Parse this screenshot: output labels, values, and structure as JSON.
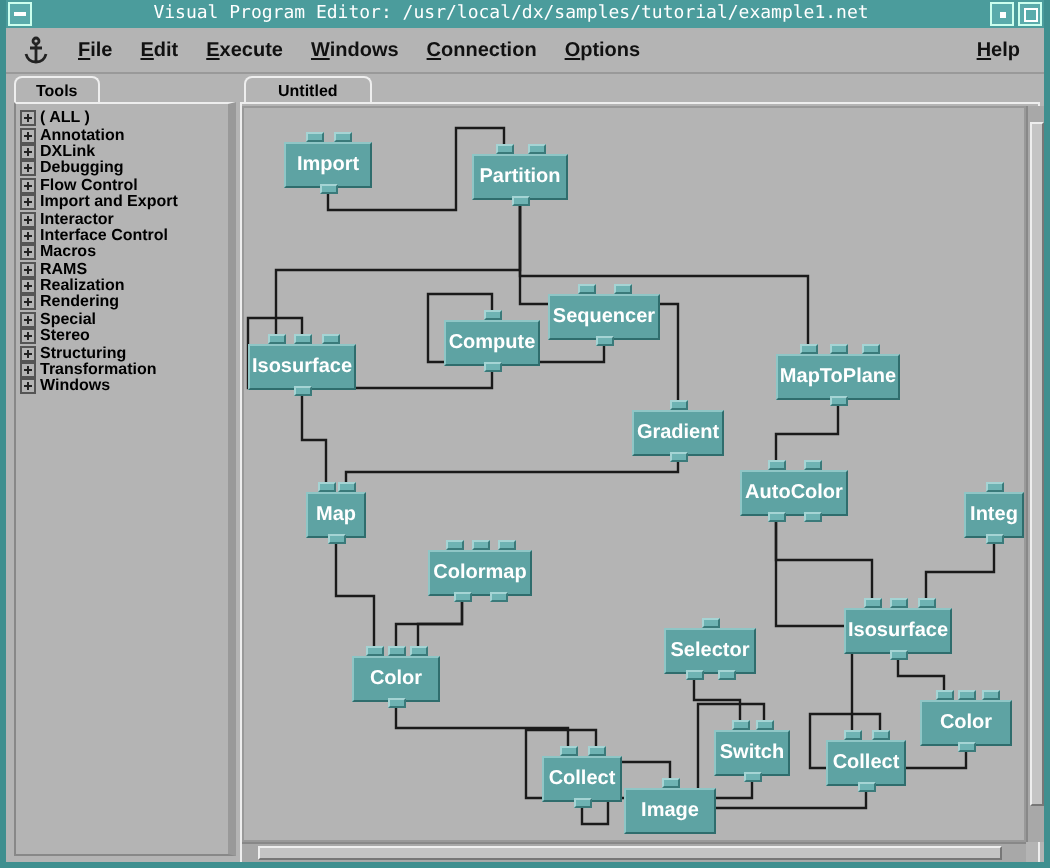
{
  "window": {
    "title": "Visual Program Editor: /usr/local/dx/samples/tutorial/example1.net"
  },
  "menus": [
    "File",
    "Edit",
    "Execute",
    "Windows",
    "Connection",
    "Options"
  ],
  "help_menu": "Help",
  "tools_panel": {
    "tab": "Tools",
    "categories": [
      "( ALL )",
      "Annotation",
      "DXLink",
      "Debugging",
      "Flow Control",
      "Import and Export",
      "Interactor",
      "Interface Control",
      "Macros",
      "RAMS",
      "Realization",
      "Rendering",
      "Special",
      "Stereo",
      "Structuring",
      "Transformation",
      "Windows"
    ]
  },
  "canvas": {
    "tab": "Untitled",
    "modules": [
      {
        "label": "Import"
      },
      {
        "label": "Partition"
      },
      {
        "label": "Isosurface"
      },
      {
        "label": "Compute"
      },
      {
        "label": "Sequencer"
      },
      {
        "label": "Gradient"
      },
      {
        "label": "MapToPlane"
      },
      {
        "label": "AutoColor"
      },
      {
        "label": "Map"
      },
      {
        "label": "Colormap"
      },
      {
        "label": "Color"
      },
      {
        "label": "Selector"
      },
      {
        "label": "Switch"
      },
      {
        "label": "Collect"
      },
      {
        "label": "Image"
      },
      {
        "label": "Isosurface"
      },
      {
        "label": "Integ"
      },
      {
        "label": "Color"
      },
      {
        "label": "Collect"
      }
    ]
  }
}
